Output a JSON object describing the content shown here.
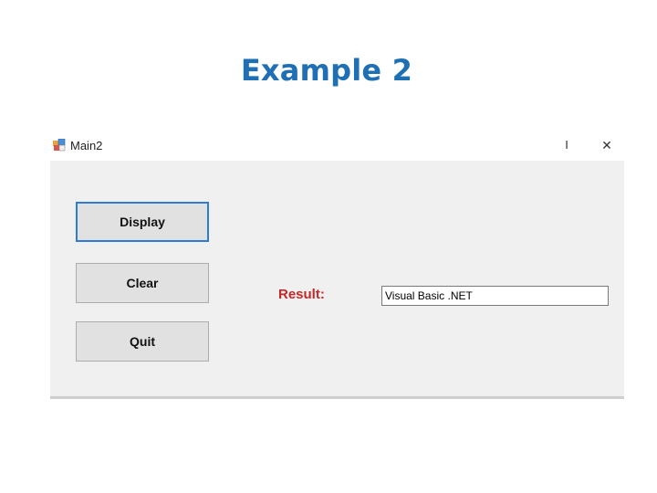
{
  "slide": {
    "title": "Example 2"
  },
  "window": {
    "title": "Main2",
    "minimize_glyph": "I",
    "close_glyph": "✕"
  },
  "buttons": {
    "display_label": "Display",
    "clear_label": "Clear",
    "quit_label": "Quit"
  },
  "result": {
    "label": "Result:",
    "value": "Visual Basic .NET"
  },
  "colors": {
    "title_blue": "#1f6fb4",
    "label_red": "#c62828",
    "focus_border": "#2e7bd0",
    "form_background": "#f0f0f0"
  }
}
